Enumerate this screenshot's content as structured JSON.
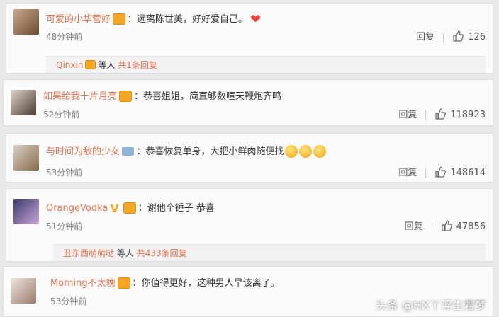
{
  "comments": [
    {
      "user": "可爱的小华营好",
      "text": "：远离陈世美，好好爱自己。",
      "time": "48分钟前",
      "reply": "回复",
      "likes": "126"
    },
    {
      "user": "如果给我十片月亮",
      "text": "：恭喜姐姐，简直够数喧天鞭炮齐鸣",
      "time": "52分钟前",
      "reply": "回复",
      "likes": "118923"
    },
    {
      "user": "与时间为敌的少女",
      "text": "：恭喜恢复单身，大把小鲜肉随便找",
      "time": "53分钟前",
      "reply": "回复",
      "likes": "148614"
    },
    {
      "user": "OrangeVodka",
      "text": "：谢他个锤子 恭喜",
      "time": "51分钟前",
      "reply": "回复",
      "likes": "47856"
    },
    {
      "user": "Morning不太晚",
      "text": "：你值得更好，这种男人早该离了。",
      "time": "53分钟前"
    }
  ],
  "subreplies": [
    {
      "user": "Qinxin",
      "mid": "等人",
      "count": "共1条回复"
    },
    {
      "user": "丑东西萌萌哒",
      "mid": "等人",
      "count": "共433条回复"
    }
  ],
  "watermark": "头条 @HX丫浮生若梦",
  "colors": {
    "username": "#eb7350",
    "heart": "#e8413a"
  }
}
